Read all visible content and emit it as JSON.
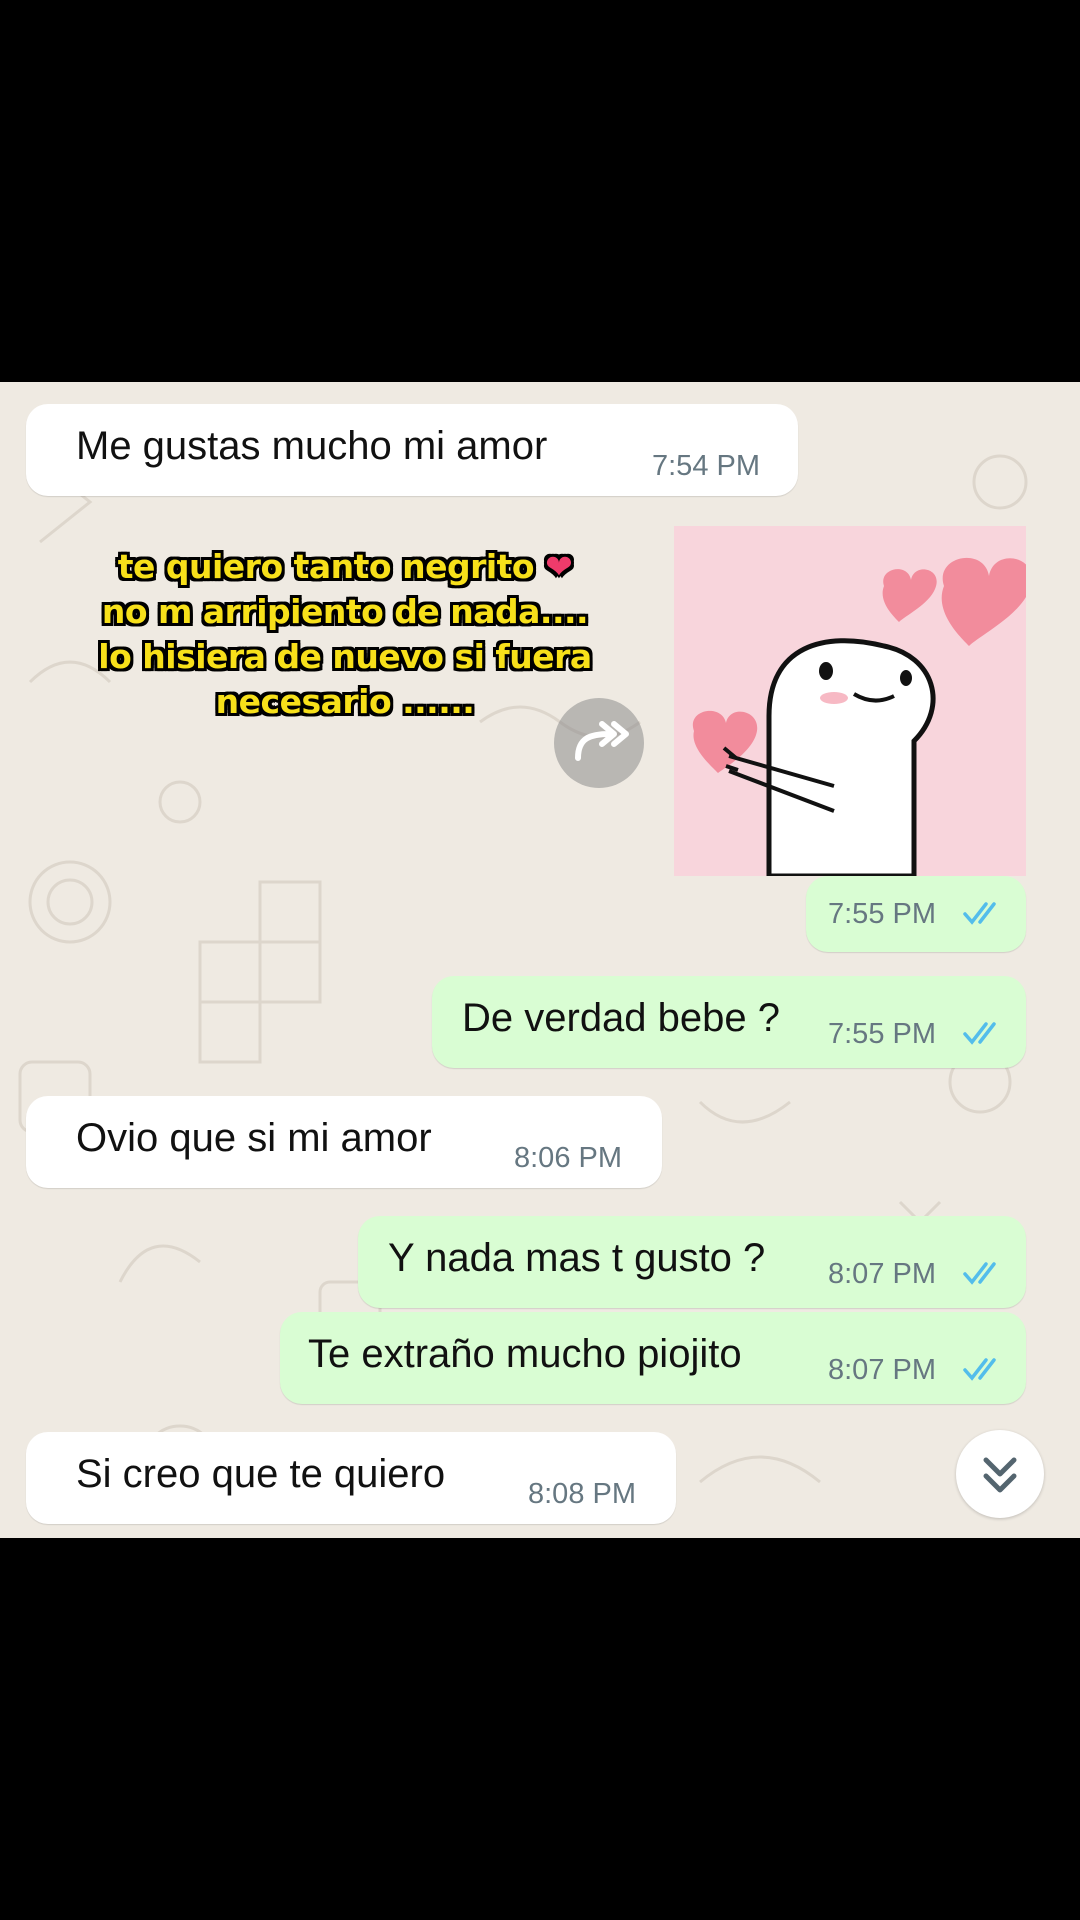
{
  "messages": [
    {
      "direction": "incoming",
      "text": "Me gustas mucho mi amor",
      "time": "7:54 PM"
    },
    {
      "direction": "outgoing",
      "type": "sticker",
      "time": "7:55 PM",
      "status": "read"
    },
    {
      "direction": "outgoing",
      "text": "De verdad bebe ?",
      "time": "7:55 PM",
      "status": "read"
    },
    {
      "direction": "incoming",
      "text": "Ovio que si mi amor",
      "time": "8:06 PM"
    },
    {
      "direction": "outgoing",
      "text": "Y nada mas t gusto ?",
      "time": "8:07 PM",
      "status": "read"
    },
    {
      "direction": "outgoing",
      "text": "Te extraño mucho piojito",
      "time": "8:07 PM",
      "status": "read"
    },
    {
      "direction": "incoming",
      "text": "Si creo que te quiero",
      "time": "8:08 PM"
    }
  ],
  "overlay": {
    "line1": "te quiero tanto negrito",
    "heart": "❤",
    "line2": "no m arripiento de nada....",
    "line3": "lo hisiera de nuevo si fuera",
    "line4": "necesario ......"
  },
  "icons": {
    "forward": "forward-icon",
    "scroll_down": "double-chevron-down-icon",
    "read_receipt": "double-check-icon"
  },
  "colors": {
    "chat_bg": "#efeae2",
    "incoming_bubble": "#ffffff",
    "outgoing_bubble": "#d9fdd3",
    "read_tick": "#53bdeb",
    "overlay_text": "#f7e01a"
  }
}
